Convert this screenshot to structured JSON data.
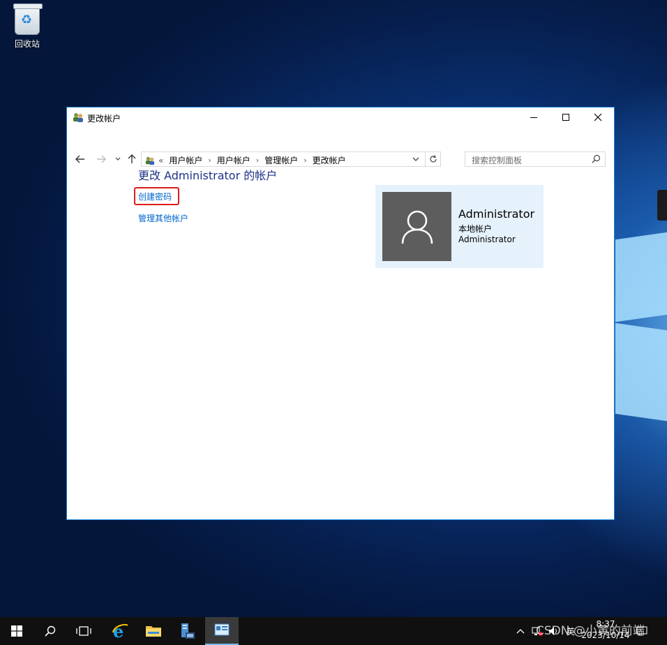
{
  "desktop": {
    "recycle_bin_label": "回收站"
  },
  "window": {
    "title": "更改帐户",
    "address": {
      "prefix": "«",
      "breadcrumbs": [
        "用户帐户",
        "用户帐户",
        "管理帐户",
        "更改帐户"
      ]
    },
    "search_placeholder": "搜索控制面板",
    "heading": "更改 Administrator 的帐户",
    "links": {
      "create_password": "创建密码",
      "manage_other": "管理其他帐户"
    },
    "user": {
      "name": "Administrator",
      "type": "本地帐户",
      "group": "Administrator"
    }
  },
  "taskbar": {
    "ime": "英",
    "time": "8:37",
    "date": "2023/10/14"
  },
  "watermark": "CSDN @小黄的前端"
}
